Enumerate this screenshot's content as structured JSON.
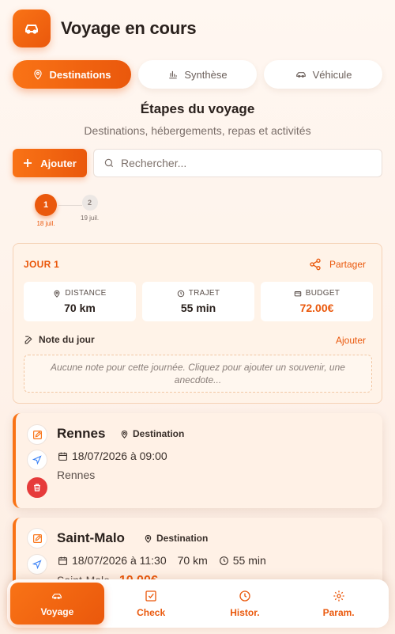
{
  "header": {
    "title": "Voyage en cours",
    "logo_icon": "car-icon"
  },
  "tabs": [
    {
      "label": "Destinations",
      "icon": "map-pin-icon",
      "active": true
    },
    {
      "label": "Synthèse",
      "icon": "bar-chart-icon",
      "active": false
    },
    {
      "label": "Véhicule",
      "icon": "car-icon",
      "active": false
    }
  ],
  "section": {
    "title": "Étapes du voyage",
    "subtitle": "Destinations, hébergements, repas et activités"
  },
  "actions": {
    "add_label": "Ajouter",
    "search_placeholder": "Rechercher..."
  },
  "days": [
    {
      "number": "1",
      "date": "18 juil.",
      "active": true
    },
    {
      "number": "2",
      "date": "19 juil.",
      "active": false
    }
  ],
  "day_card": {
    "label": "JOUR 1",
    "share_label": "Partager",
    "stats": [
      {
        "label": "DISTANCE",
        "value": "70 km",
        "icon": "map-pin-icon"
      },
      {
        "label": "TRAJET",
        "value": "55 min",
        "icon": "clock-icon"
      },
      {
        "label": "BUDGET",
        "value": "72.00€",
        "icon": "wallet-icon"
      }
    ],
    "note_title": "Note du jour",
    "note_add": "Ajouter",
    "note_placeholder": "Aucune note pour cette journée. Cliquez pour ajouter un souvenir, une anecdote..."
  },
  "destinations": [
    {
      "name": "Rennes",
      "type": "Destination",
      "datetime": "18/07/2026 à 09:00",
      "place": "Rennes"
    },
    {
      "name": "Saint-Malo",
      "type": "Destination",
      "datetime": "18/07/2026 à 11:30",
      "distance": "70 km",
      "duration": "55 min",
      "place": "Saint-Malo",
      "price": "10.00€"
    }
  ],
  "nav": [
    {
      "label": "Voyage",
      "icon": "car-icon",
      "active": true
    },
    {
      "label": "Check",
      "icon": "checkbox-icon",
      "active": false
    },
    {
      "label": "Histor.",
      "icon": "clock-icon",
      "active": false
    },
    {
      "label": "Param.",
      "icon": "gear-icon",
      "active": false
    }
  ],
  "colors": {
    "accent": "#ea580c",
    "accent_light": "#f97316",
    "danger": "#e63b3b"
  }
}
